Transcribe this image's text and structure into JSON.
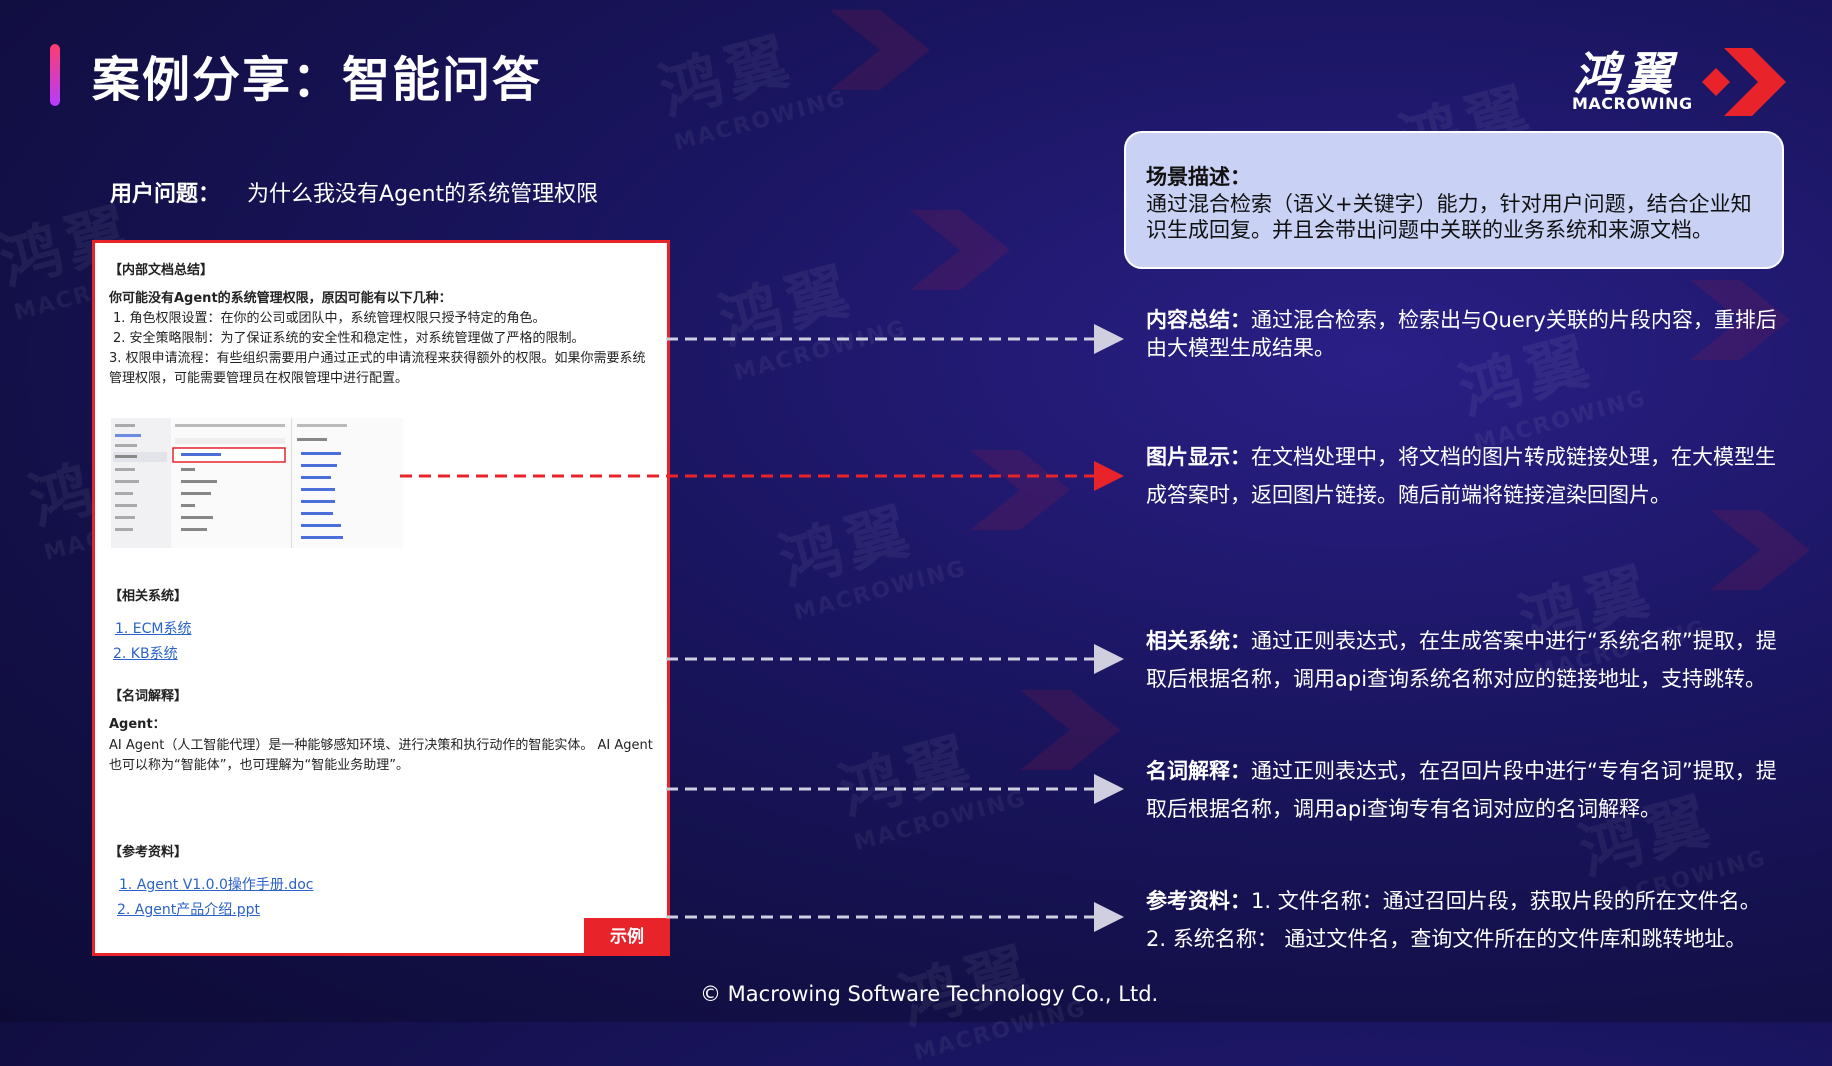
{
  "slide": {
    "title": "案例分享：智能问答",
    "logo_cn": "鸿翼",
    "logo_en": "MACROWING",
    "copyright": "© Macrowing Software Technology Co., Ltd.",
    "watermark_cn": "鸿翼",
    "watermark_en": "MACROWING"
  },
  "question": {
    "label": "用户问题：",
    "text": "为什么我没有Agent的系统管理权限"
  },
  "doc": {
    "summary_heading": "【内部文档总结】",
    "summary_intro": "你可能没有Agent的系统管理权限，原因可能有以下几种：",
    "summary_items": [
      "1. 角色权限设置：在你的公司或团队中，系统管理权限只授予特定的角色。",
      "2. 安全策略限制：为了保证系统的安全性和稳定性，对系统管理做了严格的限制。",
      "3. 权限申请流程：有些组织需要用户通过正式的申请流程来获得额外的权限。如果你需要系统管理权限，可能需要管理员在权限管理中进行配置。"
    ],
    "systems_heading": "【相关系统】",
    "systems": [
      "1. ECM系统",
      "2. KB系统"
    ],
    "terms_heading": "【名词解释】",
    "term_name": "Agent：",
    "term_desc": "AI Agent（人工智能代理）是一种能够感知环境、进行决策和执行动作的智能实体。 AI Agent也可以称为“智能体”，也可理解为“智能业务助理”。",
    "refs_heading": "【参考资料】",
    "refs": [
      "1. Agent V1.0.0操作手册.doc",
      "2. Agent产品介绍.ppt"
    ],
    "badge": "示例"
  },
  "scene": {
    "label": "场景描述：",
    "text": "通过混合检索（语义+关键字）能力，针对用户问题，结合企业知识生成回复。并且会带出问题中关联的业务系统和来源文档。"
  },
  "descriptions": [
    {
      "label": "内容总结：",
      "text": "通过混合检索，检索出与Query关联的片段内容，重排后由大模型生成结果。"
    },
    {
      "label": "图片显示：",
      "text": "在文档处理中，将文档的图片转成链接处理，在大模型生成答案时，返回图片链接。随后前端将链接渲染回图片。"
    },
    {
      "label": "相关系统：",
      "text": "通过正则表达式，在生成答案中进行“系统名称”提取，提取后根据名称，调用api查询系统名称对应的链接地址，支持跳转。"
    },
    {
      "label": "名词解释：",
      "text": "通过正则表达式，在召回片段中进行“专有名词”提取，提取后根据名称，调用api查询专有名词对应的名词解释。"
    },
    {
      "label": "参考资料：",
      "text": "1. 文件名称：通过召回片段，获取片段的所在文件名。",
      "text2": "2. 系统名称： 通过文件名，查询文件所在的文件库和跳转地址。"
    }
  ],
  "colors": {
    "accent_red": "#e8232a",
    "link_blue": "#2b63c8",
    "scene_bg": "#c9d2f4",
    "bg_dark": "#120f45"
  }
}
